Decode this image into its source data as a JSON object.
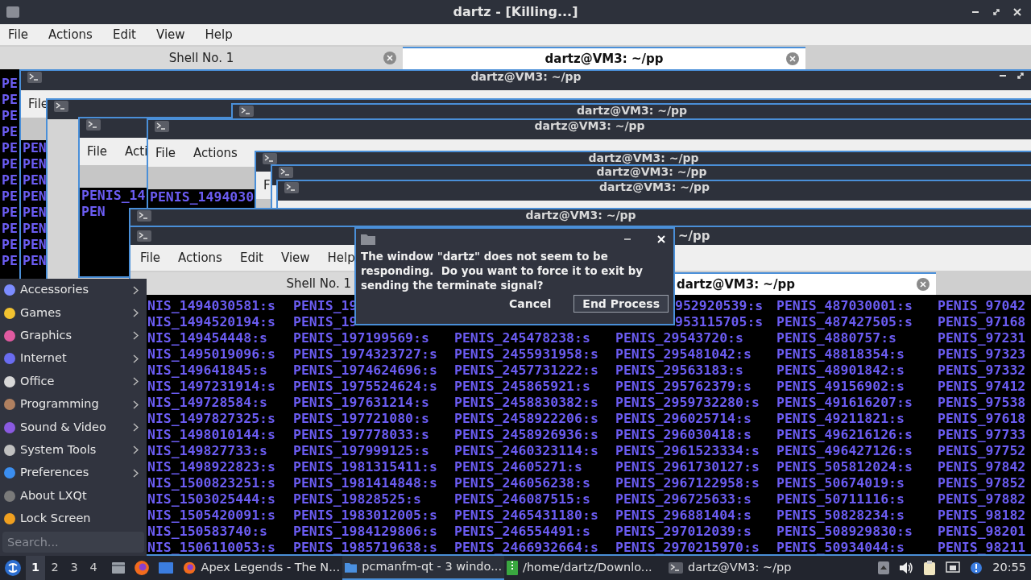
{
  "main_window": {
    "title": "dartz - [Killing...]",
    "menu": [
      "File",
      "Actions",
      "Edit",
      "View",
      "Help"
    ],
    "tabs": [
      {
        "label": "Shell No. 1",
        "selected": false
      },
      {
        "label": "dartz@VM3: ~/pp",
        "selected": true
      }
    ],
    "terminal_lines": [
      "PE",
      "PE",
      "PE",
      "PE",
      "PE",
      "PE",
      "PE",
      "PE",
      "PE",
      "PE",
      "PE",
      "PE"
    ]
  },
  "background_windows": [
    {
      "title": "dartz@VM3: ~/pp",
      "menu": [
        "File"
      ],
      "lines": [
        "PEN",
        "PEN",
        "PEN",
        "PEN",
        "PEN",
        "PEN",
        "PEN",
        "PEN"
      ]
    },
    {
      "menu": [
        "File",
        "Acti"
      ],
      "lines": [
        "PENIS_14",
        "PEN"
      ]
    },
    {
      "title": "dartz@VM3: ~/pp"
    },
    {
      "title": "dartz@VM3: ~/pp",
      "menu": [
        "File",
        "Actions"
      ],
      "lines": [
        "PENIS_1494030"
      ]
    },
    {
      "title": "dartz@VM3: ~/pp",
      "menu": [
        "F"
      ]
    },
    {
      "title": "dartz@VM3: ~/pp"
    },
    {
      "title": "dartz@VM3: ~/pp"
    },
    {
      "title": "dartz@VM3: ~/pp"
    }
  ],
  "terminal": {
    "title": "~/pp",
    "menu": [
      "File",
      "Actions",
      "Edit",
      "View",
      "Help"
    ],
    "tabs": [
      {
        "label": "Shell No. 1",
        "selected": false
      },
      {
        "label": "dartz@VM3: ~/pp",
        "selected": true
      }
    ],
    "rows": [
      [
        {
          "text": "NIS_1494030581:s"
        },
        {
          "text": "PENIS_19"
        },
        {},
        {
          "text": "952920539:s",
          "clipped": true
        },
        {
          "text": "PENIS_487030001:s"
        },
        {
          "text": "PENIS_97042"
        }
      ],
      [
        {
          "text": "NIS_1494520194:s"
        },
        {
          "text": "PENIS_19"
        },
        {},
        {
          "text": "953115705:s",
          "clipped": true
        },
        {
          "text": "PENIS_487427505:s"
        },
        {
          "text": "PENIS_97168"
        }
      ],
      [
        {
          "text": "NIS_149454448:s"
        },
        {
          "text": "PENIS_197199569:s"
        },
        {
          "text": "PENIS_245478238:s"
        },
        {
          "text": "PENIS_29543720:s"
        },
        {
          "text": "PENIS_4880757:s"
        },
        {
          "text": "PENIS_97231"
        }
      ],
      [
        {
          "text": "NIS_1495019096:s"
        },
        {
          "text": "PENIS_1974323727:s"
        },
        {
          "text": "PENIS_2455931958:s"
        },
        {
          "text": "PENIS_295481042:s"
        },
        {
          "text": "PENIS_48818354:s"
        },
        {
          "text": "PENIS_97323"
        }
      ],
      [
        {
          "text": "NIS_149641845:s"
        },
        {
          "text": "PENIS_1974624696:s"
        },
        {
          "text": "PENIS_2457731222:s"
        },
        {
          "text": "PENIS_29563183:s"
        },
        {
          "text": "PENIS_48901842:s"
        },
        {
          "text": "PENIS_97332"
        }
      ],
      [
        {
          "text": "NIS_1497231914:s"
        },
        {
          "text": "PENIS_1975524624:s"
        },
        {
          "text": "PENIS_245865921:s"
        },
        {
          "text": "PENIS_295762379:s"
        },
        {
          "text": "PENIS_49156902:s"
        },
        {
          "text": "PENIS_97412"
        }
      ],
      [
        {
          "text": "NIS_149728584:s"
        },
        {
          "text": "PENIS_197631214:s"
        },
        {
          "text": "PENIS_2458830382:s"
        },
        {
          "text": "PENIS_2959732280:s"
        },
        {
          "text": "PENIS_491616207:s"
        },
        {
          "text": "PENIS_97538"
        }
      ],
      [
        {
          "text": "NIS_1497827325:s"
        },
        {
          "text": "PENIS_197721080:s"
        },
        {
          "text": "PENIS_2458922206:s"
        },
        {
          "text": "PENIS_296025714:s"
        },
        {
          "text": "PENIS_49211821:s"
        },
        {
          "text": "PENIS_97618"
        }
      ],
      [
        {
          "text": "NIS_1498010144:s"
        },
        {
          "text": "PENIS_197778033:s"
        },
        {
          "text": "PENIS_2458926936:s"
        },
        {
          "text": "PENIS_296030418:s"
        },
        {
          "text": "PENIS_496216126:s"
        },
        {
          "text": "PENIS_97733"
        }
      ],
      [
        {
          "text": "NIS_149827733:s"
        },
        {
          "text": "PENIS_197999125:s"
        },
        {
          "text": "PENIS_2460323114:s"
        },
        {
          "text": "PENIS_2961523334:s"
        },
        {
          "text": "PENIS_496427126:s"
        },
        {
          "text": "PENIS_97752"
        }
      ],
      [
        {
          "text": "NIS_1498922823:s"
        },
        {
          "text": "PENIS_1981315411:s"
        },
        {
          "text": "PENIS_24605271:s"
        },
        {
          "text": "PENIS_2961730127:s"
        },
        {
          "text": "PENIS_505812024:s"
        },
        {
          "text": "PENIS_97842"
        }
      ],
      [
        {
          "text": "NIS_1500823251:s"
        },
        {
          "text": "PENIS_1981414848:s"
        },
        {
          "text": "PENIS_246056238:s"
        },
        {
          "text": "PENIS_2967122958:s"
        },
        {
          "text": "PENIS_50674019:s"
        },
        {
          "text": "PENIS_97852"
        }
      ],
      [
        {
          "text": "NIS_1503025444:s"
        },
        {
          "text": "PENIS_19828525:s"
        },
        {
          "text": "PENIS_246087515:s"
        },
        {
          "text": "PENIS_296725633:s"
        },
        {
          "text": "PENIS_50711116:s"
        },
        {
          "text": "PENIS_97882"
        }
      ],
      [
        {
          "text": "NIS_1505420091:s"
        },
        {
          "text": "PENIS_1983012005:s"
        },
        {
          "text": "PENIS_2465431180:s"
        },
        {
          "text": "PENIS_296881404:s"
        },
        {
          "text": "PENIS_50828234:s"
        },
        {
          "text": "PENIS_98182"
        }
      ],
      [
        {
          "text": "NIS_150583740:s"
        },
        {
          "text": "PENIS_1984129806:s"
        },
        {
          "text": "PENIS_246554491:s"
        },
        {
          "text": "PENIS_297012039:s"
        },
        {
          "text": "PENIS_508929830:s"
        },
        {
          "text": "PENIS_98201"
        }
      ],
      [
        {
          "text": "NIS_1506110053:s"
        },
        {
          "text": "PENIS_1985719638:s"
        },
        {
          "text": "PENIS_2466932664:s"
        },
        {
          "text": "PENIS_2970215970:s"
        },
        {
          "text": "PENIS_50934044:s"
        },
        {
          "text": "PENIS_98211"
        }
      ]
    ]
  },
  "start_menu": {
    "items": [
      {
        "label": "Accessories",
        "submenu": true
      },
      {
        "label": "Games",
        "submenu": true
      },
      {
        "label": "Graphics",
        "submenu": true
      },
      {
        "label": "Internet",
        "submenu": true
      },
      {
        "label": "Office",
        "submenu": true
      },
      {
        "label": "Programming",
        "submenu": true
      },
      {
        "label": "Sound & Video",
        "submenu": true
      },
      {
        "label": "System Tools",
        "submenu": true
      },
      {
        "label": "Preferences",
        "submenu": true
      },
      {
        "label": "About LXQt",
        "submenu": false
      },
      {
        "label": "Lock Screen",
        "submenu": false
      }
    ],
    "search": {
      "placeholder": "Search..."
    }
  },
  "dialog": {
    "message": "The window \"dartz\" does not seem to be responding.  Do you want to force it to exit by sending the terminate signal?",
    "buttons": [
      {
        "label": "Cancel",
        "focused": false
      },
      {
        "label": "End Process",
        "focused": true
      }
    ]
  },
  "taskbar": {
    "desktops": [
      {
        "label": "1",
        "selected": true
      },
      {
        "label": "2",
        "selected": false
      },
      {
        "label": "3",
        "selected": false
      },
      {
        "label": "4",
        "selected": false
      }
    ],
    "tasks": [
      {
        "label": "Apex Legends - The N...",
        "selected": false
      },
      {
        "label": "pcmanfm-qt - 3 windo...",
        "selected": true
      },
      {
        "label": "/home/dartz/Downlo...",
        "selected": false
      },
      {
        "label": "dartz@VM3: ~/pp",
        "selected": false
      }
    ],
    "clock": "20:55"
  }
}
